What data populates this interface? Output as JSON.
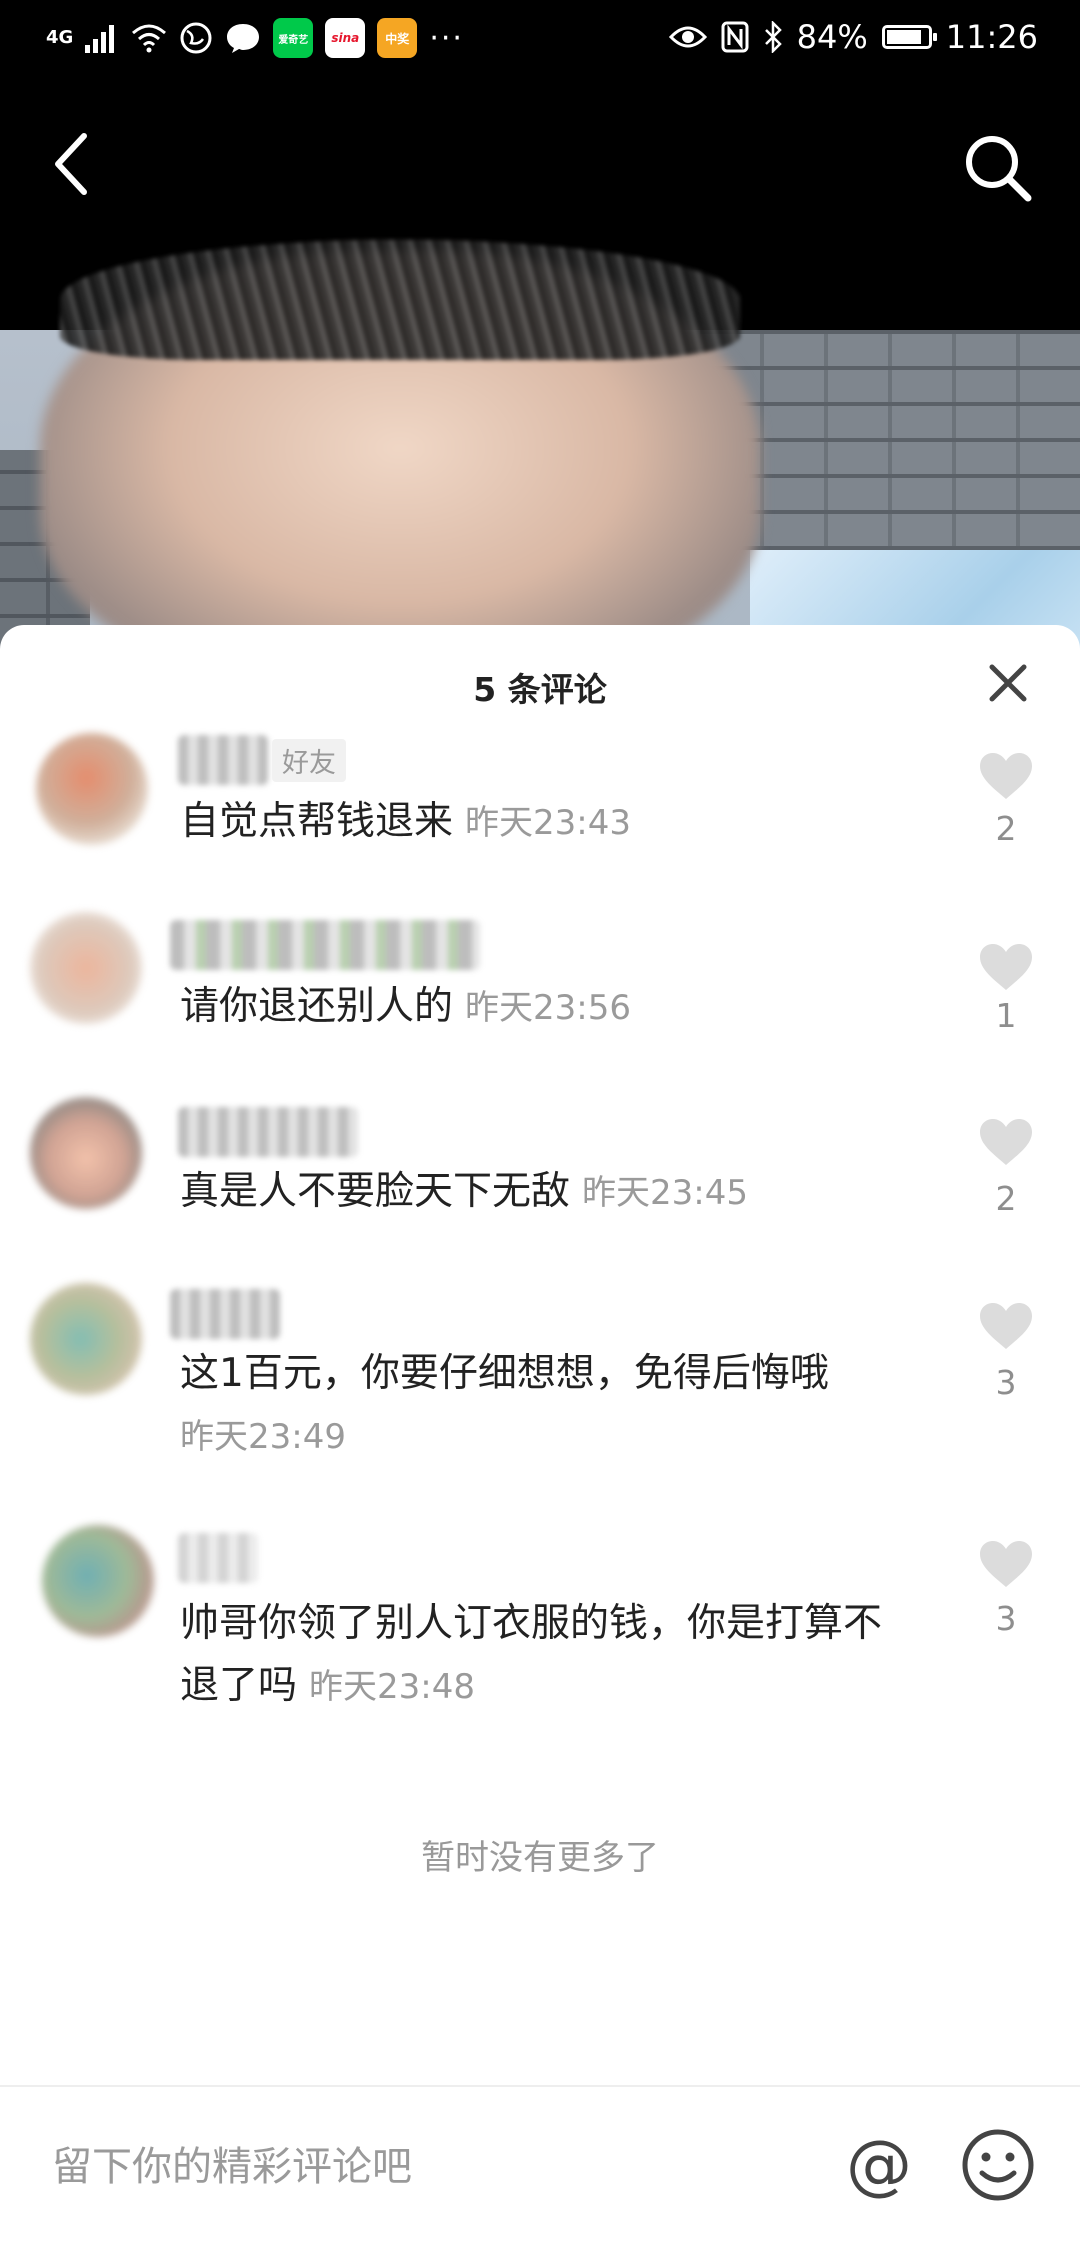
{
  "status_bar": {
    "network": "4G",
    "app_icons": [
      {
        "name": "iqiyi-icon",
        "label": "爱奇艺",
        "color": "#00c94a"
      },
      {
        "name": "sina-icon",
        "label": "sina",
        "color": "#e6162d"
      },
      {
        "name": "game-app-icon",
        "label": "中奖",
        "color": "#f5a623"
      }
    ],
    "more": "···",
    "battery": "84%",
    "battery_level": 0.84,
    "time": "11:26"
  },
  "nav": {
    "back_icon": "chevron-left-icon",
    "search_icon": "search-icon"
  },
  "comments_panel": {
    "title": "5 条评论",
    "close_icon": "close-icon",
    "comments": [
      {
        "text": "自觉点帮钱退来",
        "time": "昨天23:43",
        "likes": "2",
        "tag": "好友"
      },
      {
        "text": "请你退还别人的",
        "time": "昨天23:56",
        "likes": "1"
      },
      {
        "text": "真是人不要脸天下无敌",
        "time": "昨天23:45",
        "likes": "2"
      },
      {
        "text": "这1百元，你要仔细想想，免得后悔哦",
        "time": "昨天23:49",
        "likes": "3"
      },
      {
        "text": "帅哥你领了别人订衣服的钱，你是打算不退了吗",
        "time": "昨天23:48",
        "likes": "3"
      }
    ],
    "no_more": "暂时没有更多了"
  },
  "input_bar": {
    "placeholder": "留下你的精彩评论吧",
    "value": "",
    "at_symbol": "@",
    "emoji_icon": "smiley-icon"
  },
  "colors": {
    "like_heart": "#dcdcdc",
    "time_gray": "#9a9a9a",
    "text_dark": "#222222"
  }
}
